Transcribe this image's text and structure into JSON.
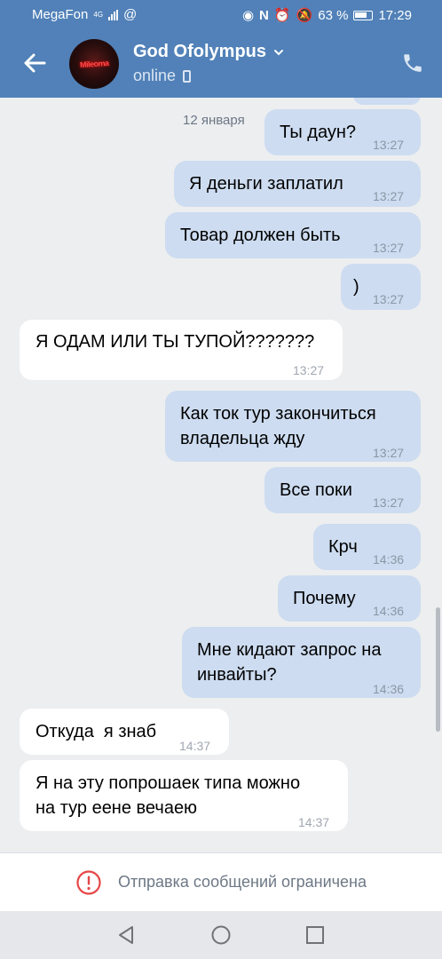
{
  "status_bar": {
    "carrier": "MegaFon",
    "network": "4G",
    "extra": "@",
    "battery": "63 %",
    "time": "17:29"
  },
  "header": {
    "name": "God Ofolympus",
    "status": "online",
    "avatar_text": "Mileoma"
  },
  "chat": {
    "date_label": "12 января",
    "messages": [
      {
        "dir": "out",
        "text": "Ты даун?",
        "time": "13:27"
      },
      {
        "dir": "out",
        "text": "Я деньги заплатил",
        "time": "13:27"
      },
      {
        "dir": "out",
        "text": "Товар должен быть",
        "time": "13:27"
      },
      {
        "dir": "out",
        "text": ")",
        "time": "13:27"
      },
      {
        "dir": "in",
        "text": "Я ОДАМ ИЛИ ТЫ ТУПОЙ???????",
        "time": "13:27"
      },
      {
        "dir": "out",
        "text_lines": [
          "Как ток тур закончиться",
          "владельца жду"
        ],
        "time": "13:27"
      },
      {
        "dir": "out",
        "text": "Все поки",
        "time": "13:27"
      },
      {
        "dir": "out",
        "text": "Крч",
        "time": "14:36"
      },
      {
        "dir": "out",
        "text": "Почему",
        "time": "14:36"
      },
      {
        "dir": "out",
        "text_lines": [
          "Мне кидают запрос на",
          "инвайты?"
        ],
        "time": "14:36"
      },
      {
        "dir": "in",
        "text": "Откуда  я знаб",
        "time": "14:37"
      },
      {
        "dir": "in",
        "text_lines": [
          "Я на эту попрошаек типа можно",
          "на тур еене вечаею"
        ],
        "time": "14:37"
      }
    ]
  },
  "restriction": {
    "text": "Отправка сообщений ограничена"
  },
  "colors": {
    "header_bg": "#5181b8",
    "outgoing_bubble": "#cddcf0",
    "incoming_bubble": "#ffffff",
    "chat_bg": "#edeef0",
    "warning_red": "#e64646"
  }
}
